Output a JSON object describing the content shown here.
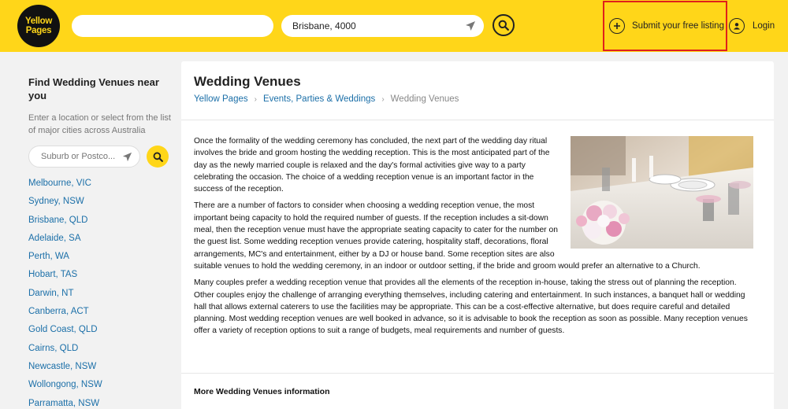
{
  "header": {
    "logo_line1": "Yellow",
    "logo_line2": "Pages",
    "what_value": "",
    "where_value": "Brisbane, 4000",
    "submit_label": "Submit your free listing",
    "login_label": "Login"
  },
  "sidebar": {
    "title": "Find Wedding Venues near you",
    "description": "Enter a location or select from the list of major cities across Australia",
    "search_placeholder": "Suburb or Postco...",
    "cities": [
      "Melbourne, VIC",
      "Sydney, NSW",
      "Brisbane, QLD",
      "Adelaide, SA",
      "Perth, WA",
      "Hobart, TAS",
      "Darwin, NT",
      "Canberra, ACT",
      "Gold Coast, QLD",
      "Cairns, QLD",
      "Newcastle, NSW",
      "Wollongong, NSW",
      "Parramatta, NSW"
    ]
  },
  "main": {
    "title": "Wedding Venues",
    "breadcrumb": [
      "Yellow Pages",
      "Events, Parties & Weddings",
      "Wedding Venues"
    ],
    "paragraphs": [
      "Once the formality of the wedding ceremony has concluded, the next part of the wedding day ritual involves the bride and groom hosting the wedding reception. This is the most anticipated part of the day as the newly married couple is relaxed and the day's formal activities give way to a party celebrating the occasion. The choice of a wedding reception venue is an important factor in the success of the reception.",
      "There are a number of factors to consider when choosing a wedding reception venue, the most important being capacity to hold the required number of guests. If the reception includes a sit-down meal, then the reception venue must have the appropriate seating capacity to cater for the number on the guest list. Some wedding reception venues provide catering, hospitality staff, decorations, floral arrangements, MC's and entertainment, either by a DJ or house band. Some reception sites are also suitable venues to hold the wedding ceremony, in an indoor or outdoor setting, if the bride and groom would prefer an alternative to a Church.",
      "Many couples prefer a wedding reception venue that provides all the elements of the reception in-house, taking the stress out of planning the reception. Other couples enjoy the challenge of arranging everything themselves, including catering and entertainment. In such instances, a banquet hall or wedding hall that allows external caterers to use the facilities may be appropriate. This can be a cost-effective alternative, but does require careful and detailed planning. Most wedding reception venues are well booked in advance, so it is advisable to book the reception as soon as possible. Many reception venues offer a variety of reception options to suit a range of budgets, meal requirements and number of guests."
    ],
    "more_title": "More Wedding Venues information"
  },
  "colors": {
    "brand_yellow": "#ffd619",
    "link_blue": "#1b6fa8",
    "highlight_red": "#e0201b"
  },
  "icons": [
    "location-arrow-icon",
    "search-icon",
    "plus-icon",
    "user-icon"
  ]
}
